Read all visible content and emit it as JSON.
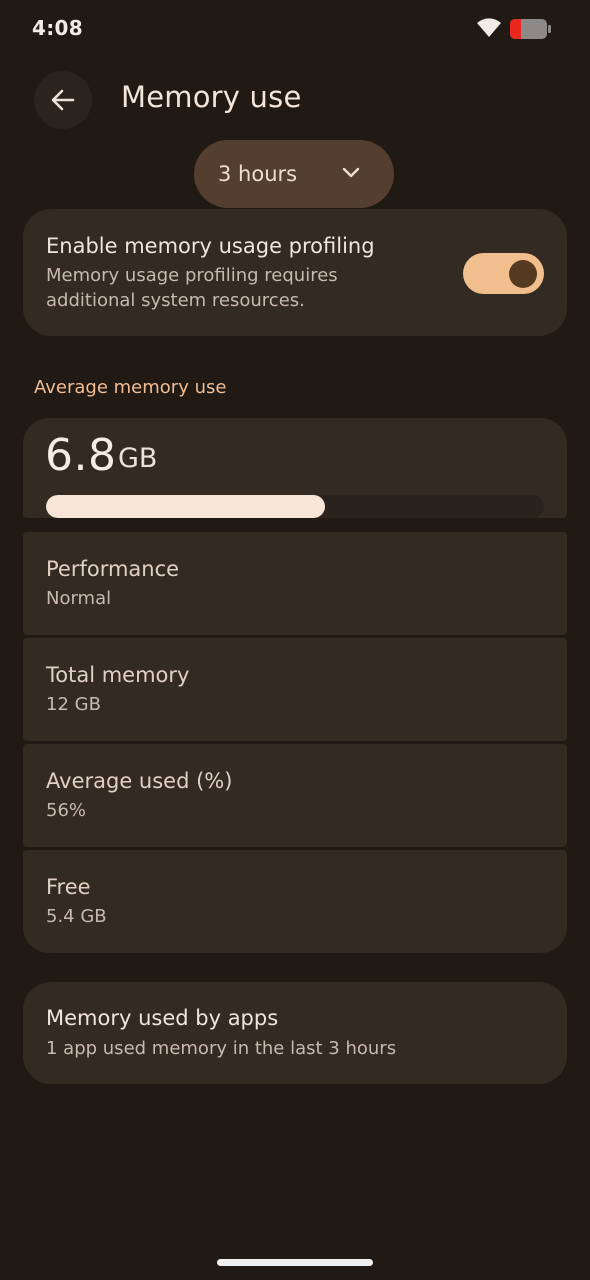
{
  "status_bar": {
    "time": "4:08",
    "battery_color": "#e8271f"
  },
  "header": {
    "title": "Memory use",
    "back_icon": "arrow-left-icon"
  },
  "range_selector": {
    "selected": "3 hours",
    "icon": "chevron-down-icon"
  },
  "profiling": {
    "title": "Enable memory usage profiling",
    "description_line1": "Memory usage profiling requires",
    "description_line2": "additional system resources.",
    "enabled": true
  },
  "average": {
    "section_title": "Average memory use",
    "value": "6.8",
    "unit": "GB",
    "used_fraction": 0.56
  },
  "stats": [
    {
      "label": "Performance",
      "value": "Normal"
    },
    {
      "label": "Total memory",
      "value": "12 GB"
    },
    {
      "label": "Average used (%)",
      "value": "56%"
    },
    {
      "label": "Free",
      "value": "5.4 GB"
    }
  ],
  "apps": {
    "title": "Memory used by apps",
    "subtitle": "1 app used memory in the last 3 hours"
  },
  "colors": {
    "background": "#201914",
    "card": "#332a22",
    "accent": "#f1bf8d",
    "section_header": "#f0bd94"
  }
}
